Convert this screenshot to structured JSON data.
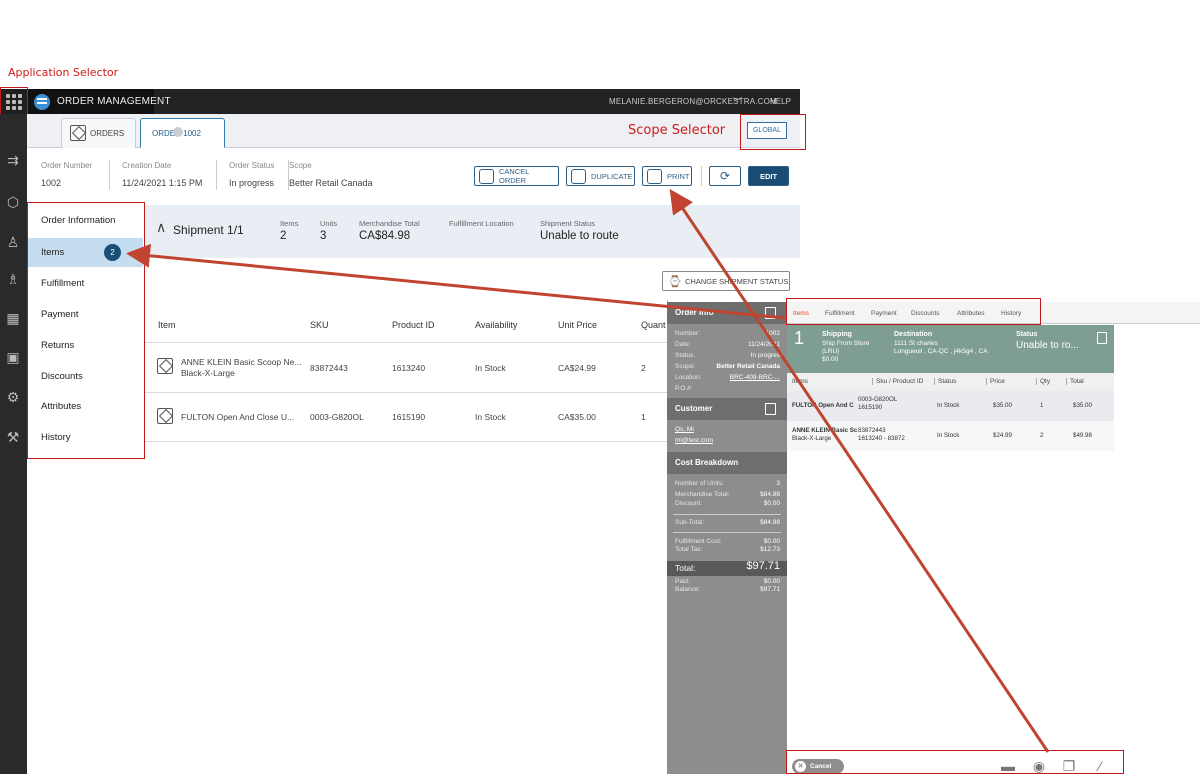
{
  "annotations": {
    "app_selector": "Application Selector",
    "scope_selector": "Scope Selector"
  },
  "appbar": {
    "title": "ORDER MANAGEMENT",
    "user": "MELANIE.BERGERON@ORCKESTRA.COM",
    "help": "HELP"
  },
  "tabs": {
    "orders": "ORDERS",
    "order": "ORDER 1002"
  },
  "scope_button": "GLOBAL",
  "header": {
    "order_number_label": "Order Number",
    "order_number": "1002",
    "creation_date_label": "Creation Date",
    "creation_date": "11/24/2021 1:15 PM",
    "status_label": "Order Status",
    "status": "In progress",
    "scope_label": "Scope",
    "scope": "Better Retail Canada"
  },
  "actions": {
    "cancel": "CANCEL ORDER",
    "duplicate": "DUPLICATE",
    "print": "PRINT",
    "edit": "EDIT"
  },
  "nav": {
    "items": [
      "Order Information",
      "Items",
      "Fulfillment",
      "Payment",
      "Returns",
      "Discounts",
      "Attributes",
      "History"
    ],
    "items_badge": "2"
  },
  "shipment": {
    "title": "Shipment 1/1",
    "items_label": "Items",
    "items": "2",
    "units_label": "Units",
    "units": "3",
    "merch_label": "Merchandise Total",
    "merch": "CA$84.98",
    "loc_label": "Fulfillment Location",
    "status_label": "Shipment Status",
    "status": "Unable to route",
    "change_btn": "CHANGE SHIPMENT STATUS"
  },
  "table": {
    "headers": [
      "Item",
      "SKU",
      "Product ID",
      "Availability",
      "Unit Price",
      "Quant"
    ],
    "rows": [
      {
        "item": "ANNE KLEIN Basic Scoop Ne...",
        "item2": "Black-X-Large",
        "sku": "83872443",
        "pid": "1613240",
        "avail": "In Stock",
        "price": "CA$24.99",
        "qty": "2"
      },
      {
        "item": "FULTON Open And Close U...",
        "item2": "",
        "sku": "0003-G820OL",
        "pid": "1615190",
        "avail": "In Stock",
        "price": "CA$35.00",
        "qty": "1"
      }
    ]
  },
  "inset": {
    "order_info": "Order Info",
    "info_rows": [
      {
        "label": "Number:",
        "value": "1002"
      },
      {
        "label": "Date:",
        "value": "11/24/2021"
      },
      {
        "label": "Status:",
        "value": "In progres"
      },
      {
        "label": "Scope:",
        "value": "Better Retail Canada"
      },
      {
        "label": "Location:",
        "value": "BRC-409-BRC-..."
      },
      {
        "label": "P.O.#:",
        "value": ""
      }
    ],
    "customer": "Customer",
    "customer_name": "Qs, Mi",
    "customer_email": "mi@test.com",
    "cost": "Cost Breakdown",
    "cost_rows": [
      {
        "label": "Number of Units:",
        "value": "3"
      },
      {
        "label": "Merchandise Total:",
        "value": "$84.98"
      },
      {
        "label": "Discount:",
        "value": "$0.00"
      },
      {
        "label": "Sub-Total:",
        "value": "$84.98"
      },
      {
        "label": "Fulfillment Cost:",
        "value": "$0.00"
      },
      {
        "label": "Total Tax:",
        "value": "$12.73"
      }
    ],
    "total_label": "Total:",
    "total": "$97.71",
    "paid_label": "Paid:",
    "paid": "$0.00",
    "balance_label": "Balance:",
    "balance": "$97.71",
    "tabs": [
      "Items",
      "Fulfillment",
      "Payment",
      "Discounts",
      "Attributes",
      "History"
    ],
    "ship_num": "1",
    "ship_title": "Shipping",
    "ship_sub": "Ship From Store",
    "ship_lru": "(LRU)",
    "ship_cost": "$0.00",
    "dest_label": "Destination",
    "dest1": "1111 St charles",
    "dest2": "Longueuil , CA-QC , j4k5g4 , CA",
    "status_label": "Status",
    "status": "Unable to ro...",
    "cols": [
      "Items",
      "Sku / Product ID",
      "Status",
      "Price",
      "Qty",
      "Total"
    ],
    "rows": [
      {
        "item": "FULTON Open And C",
        "item2": "",
        "sku": "0003-G820OL",
        "pid": "1615190",
        "status": "In Stock",
        "price": "$35.00",
        "qty": "1",
        "total": "$35.00"
      },
      {
        "item": "ANNE KLEIN Basic Sc",
        "item2": "Black-X-Large",
        "sku": "83872443",
        "pid": "1613240 - 83872",
        "status": "In Stock",
        "price": "$24.99",
        "qty": "2",
        "total": "$49.98"
      }
    ],
    "cancel": "Cancel"
  },
  "colors": {
    "accent": "#1b4c73",
    "annotation": "#c0181b",
    "arrow": "#c0442f"
  }
}
